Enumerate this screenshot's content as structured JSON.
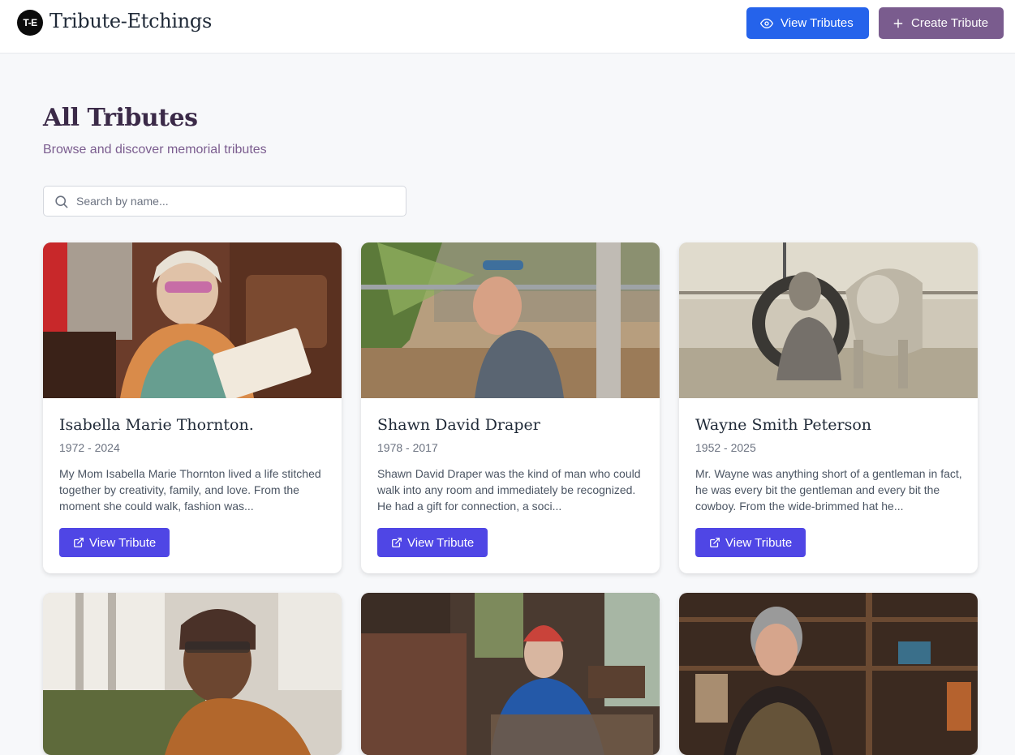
{
  "header": {
    "logo_initials": "T-E",
    "brand": "Tribute-Etchings",
    "view_tributes_label": "View Tributes",
    "create_tribute_label": "Create Tribute",
    "colors": {
      "view": "#2563eb",
      "create": "#7a5c8e"
    }
  },
  "main": {
    "title": "All Tributes",
    "subtitle": "Browse and discover memorial tributes",
    "search": {
      "placeholder": "Search by name...",
      "value": ""
    }
  },
  "cards": [
    {
      "name": "Isabella Marie Thornton.",
      "years": "1972 - 2024",
      "bio": "My Mom Isabella Marie Thornton lived a life stitched together by creativity, family, and love. From the moment she could walk, fashion was...",
      "button": "View Tribute",
      "photo_icon": "portrait-photo"
    },
    {
      "name": "Shawn David Draper",
      "years": "1978 - 2017",
      "bio": "Shawn David Draper was the kind of man who could walk into any room and immediately be recognized. He had a gift for connection, a soci...",
      "button": "View Tribute",
      "photo_icon": "portrait-photo"
    },
    {
      "name": "Wayne Smith Peterson",
      "years": "1952 - 2025",
      "bio": "Mr. Wayne was anything short of a gentleman in fact, he was every bit the gentleman and every bit the cowboy. From the wide-brimmed hat he...",
      "button": "View Tribute",
      "photo_icon": "portrait-photo"
    },
    {
      "photo_icon": "portrait-photo"
    },
    {
      "photo_icon": "portrait-photo"
    },
    {
      "photo_icon": "portrait-photo"
    }
  ]
}
